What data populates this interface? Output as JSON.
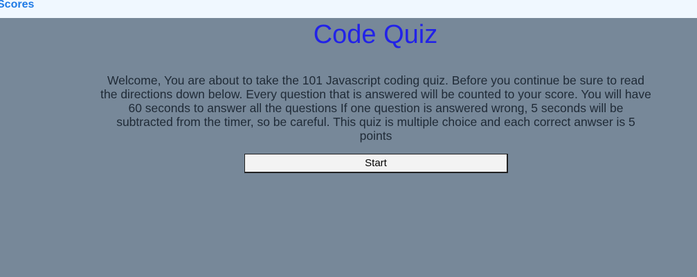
{
  "nav": {
    "scores_link": "Scores"
  },
  "quiz": {
    "title": "Code Quiz",
    "intro": "Welcome, You are about to take the 101 Javascript coding quiz. Before you continue be sure to read the directions down below. Every question that is answered will be counted to your score. You will have 60 seconds to answer all the questions If one question is answered wrong, 5 seconds will be subtracted from the timer, so be careful. This quiz is multiple choice and each correct anwser is 5 points",
    "start_label": "Start"
  },
  "colors": {
    "background": "#778899",
    "top_bar": "#f0f8ff",
    "link": "#1e7ae6",
    "title": "#2222e8",
    "text": "#1f2a36"
  }
}
